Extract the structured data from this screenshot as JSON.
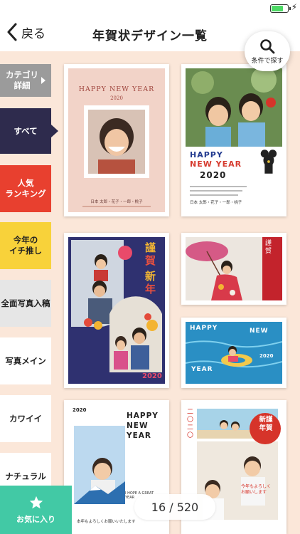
{
  "header": {
    "back_label": "戻る",
    "title": "年賀状デザイン一覧",
    "search_label": "条件で探す"
  },
  "sidebar": {
    "items": [
      {
        "label": "カテゴリ\n詳細"
      },
      {
        "label": "すべて"
      },
      {
        "label": "人気\nランキング"
      },
      {
        "label": "今年の\nイチ推し"
      },
      {
        "label": "全面写真入稿"
      },
      {
        "label": "写真メイン"
      },
      {
        "label": "カワイイ"
      },
      {
        "label": "ナチュラル"
      }
    ],
    "favorites_label": "お気に入り"
  },
  "cards": {
    "c1": {
      "top_text": "HAPPY NEW YEAR",
      "year": "2020",
      "name": "日本 太郎・花子・一郎・桃子"
    },
    "c2": {
      "line1": "HAPPY",
      "line2": "NEW YEAR",
      "year": "2020",
      "name": "日本 太郎・花子・一郎・桃子"
    },
    "c3": {
      "kanji": [
        "謹",
        "賀",
        "新",
        "年"
      ],
      "year": "2020"
    },
    "c4": {
      "kanji": "謹賀"
    },
    "c5": {
      "w1": "HAPPY",
      "w2": "NEW",
      "w3": "YEAR",
      "year": "2020"
    },
    "c6": {
      "year": "2020",
      "line1": "HAPPY",
      "line2": "NEW",
      "line3": "YEAR",
      "small": "I HOPE A GREAT YEAR",
      "greet": "本年もよろしくお願いいたします"
    },
    "c7": {
      "year": "二〇二〇",
      "badge": "新謹\n年賀",
      "greet": "今年もよろしく\nお願いします"
    }
  },
  "pagination": {
    "text": "16 / 520"
  },
  "colors": {
    "accent": "#2e2b4d",
    "background": "#fbe7d9",
    "favorites": "#42c9a5",
    "battery": "#4cd964"
  },
  "status": {
    "battery_level": 0.75
  }
}
